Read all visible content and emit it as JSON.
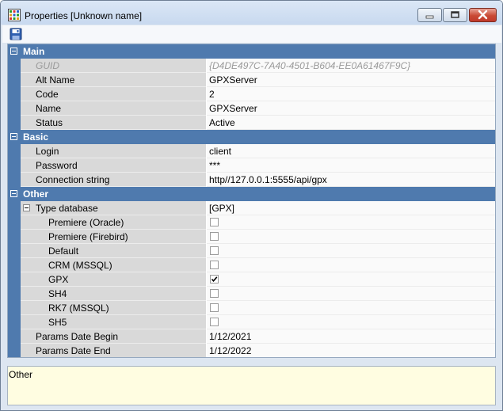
{
  "window": {
    "title": "Properties [Unknown name]"
  },
  "icons": {
    "app": "app-grid-icon",
    "save": "save-icon",
    "minimize": "minimize-icon",
    "maximize": "maximize-icon",
    "close": "close-icon"
  },
  "groups": {
    "main": "Main",
    "basic": "Basic",
    "other": "Other"
  },
  "main": [
    {
      "name": "GUID",
      "value": "{D4DE497C-7A40-4501-B604-EE0A61467F9C}"
    },
    {
      "name": "Alt Name",
      "value": "GPXServer"
    },
    {
      "name": "Code",
      "value": "2"
    },
    {
      "name": "Name",
      "value": "GPXServer"
    },
    {
      "name": "Status",
      "value": "Active"
    }
  ],
  "basic": [
    {
      "name": "Login",
      "value": "client"
    },
    {
      "name": "Password",
      "value": "***"
    },
    {
      "name": "Connection string",
      "value": "http//127.0.0.1:5555/api/gpx"
    }
  ],
  "other": {
    "type_database": {
      "name": "Type database",
      "value": "[GPX]"
    },
    "databases": [
      {
        "name": "Premiere (Oracle)",
        "checked": false
      },
      {
        "name": "Premiere (Firebird)",
        "checked": false
      },
      {
        "name": "Default",
        "checked": false
      },
      {
        "name": "CRM (MSSQL)",
        "checked": false
      },
      {
        "name": "GPX",
        "checked": true
      },
      {
        "name": "SH4",
        "checked": false
      },
      {
        "name": "RK7 (MSSQL)",
        "checked": false
      },
      {
        "name": "SH5",
        "checked": false
      }
    ],
    "params_begin": {
      "name": "Params Date Begin",
      "value": "1/12/2021"
    },
    "params_end": {
      "name": "Params Date End",
      "value": "1/12/2022"
    }
  },
  "description": {
    "text": "Other"
  },
  "colors": {
    "group_header": "#4f7aae",
    "name_cell": "#d9d9d9",
    "description_bg": "#fffde1"
  }
}
